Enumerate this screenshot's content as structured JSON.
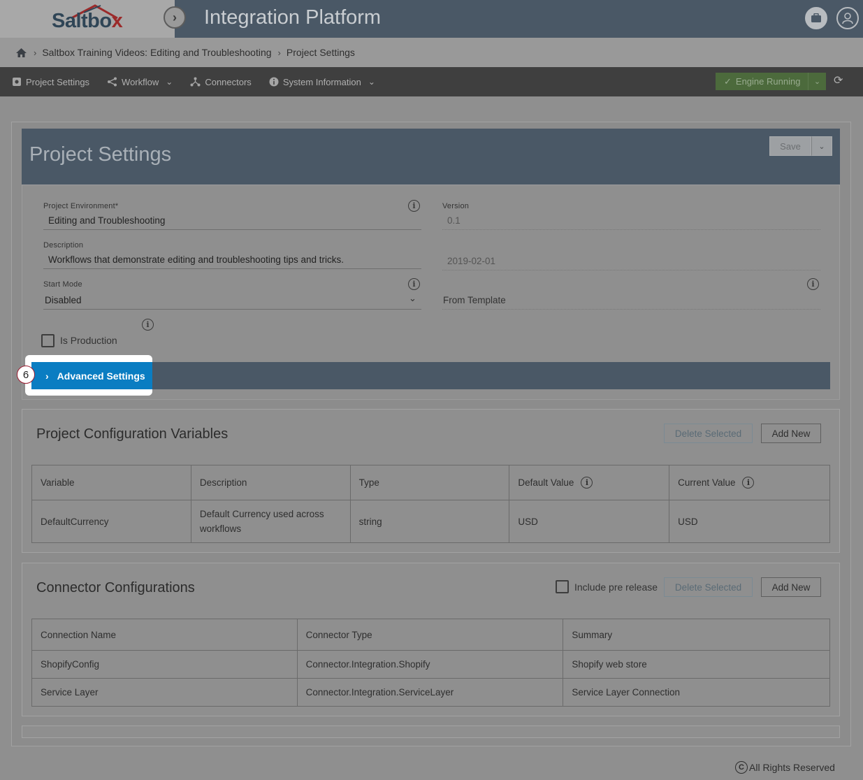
{
  "app": {
    "logo_text_a": "Saltbo",
    "logo_text_b": "x",
    "title": "Integration Platform"
  },
  "breadcrumb": {
    "items": [
      "Saltbox Training Videos: Editing and Troubleshooting",
      "Project Settings"
    ]
  },
  "nav": {
    "project_settings": "Project Settings",
    "workflow": "Workflow",
    "connectors": "Connectors",
    "system_information": "System Information",
    "engine_status": "Engine Running"
  },
  "project_settings": {
    "title": "Project Settings",
    "save_label": "Save",
    "environment_label": "Project Environment*",
    "environment_value": "Editing and Troubleshooting",
    "version_label": "Version",
    "version_value": "0.1",
    "description_label": "Description",
    "description_value": "Workflows that demonstrate editing and troubleshooting tips and tricks.",
    "date_value": "2019-02-01",
    "start_mode_label": "Start Mode",
    "start_mode_value": "Disabled",
    "template_value": "From Template",
    "is_production_label": "Is Production",
    "advanced_settings_label": "Advanced Settings",
    "step_number": "6"
  },
  "config_variables": {
    "title": "Project Configuration Variables",
    "delete_label": "Delete Selected",
    "add_label": "Add New",
    "headers": [
      "Variable",
      "Description",
      "Type",
      "Default Value",
      "Current Value"
    ],
    "rows": [
      [
        "DefaultCurrency",
        "Default Currency used across workflows",
        "string",
        "USD",
        "USD"
      ]
    ]
  },
  "connector_configs": {
    "title": "Connector Configurations",
    "include_pre_release_label": "Include pre release",
    "delete_label": "Delete Selected",
    "add_label": "Add New",
    "headers": [
      "Connection Name",
      "Connector Type",
      "Summary"
    ],
    "rows": [
      [
        "ShopifyConfig",
        "Connector.Integration.Shopify",
        "Shopify web store"
      ],
      [
        "Service Layer",
        "Connector.Integration.ServiceLayer",
        "Service Layer Connection"
      ]
    ]
  },
  "footer": {
    "copyright_symbol": "C",
    "text": "All Rights Reserved"
  },
  "colors": {
    "header_bg": "#4a5866",
    "accent_blue": "#0a7dc2",
    "engine_green": "#4c6a3c"
  },
  "icons": {
    "home": "home-icon",
    "settings": "gear-icon",
    "workflow": "share-icon",
    "connectors": "network-icon",
    "system_info": "info-icon",
    "refresh": "refresh-icon",
    "briefcase": "briefcase-icon",
    "user": "user-icon"
  }
}
